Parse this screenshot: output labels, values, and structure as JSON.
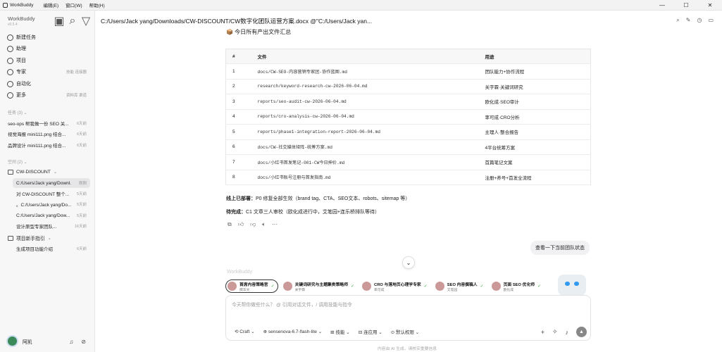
{
  "menubar": {
    "app": "WorkBuddy",
    "items": [
      "编辑(E)",
      "窗口(W)",
      "帮助(H)"
    ],
    "controls": [
      "—",
      "☐",
      "✕"
    ]
  },
  "sidebar": {
    "brand": "WorkBuddy",
    "version": "v0.5.4",
    "nav": [
      {
        "label": "新建任务",
        "hint": "",
        "icon": "edit-icon"
      },
      {
        "label": "助理",
        "hint": "",
        "icon": "assistant-icon"
      },
      {
        "label": "项目",
        "hint": "",
        "icon": "folder-icon"
      },
      {
        "label": "专家",
        "hint": "技能 连接器",
        "icon": "expert-icon"
      },
      {
        "label": "自动化",
        "hint": "",
        "icon": "clock-icon"
      },
      {
        "label": "更多",
        "hint": "资料库 渠道",
        "icon": "grid-icon"
      }
    ],
    "tasks_header": "任务 (3) ⌄",
    "tasks": [
      {
        "title": "seo-ops 帮我做一份 SEO 关...",
        "time": "6天前"
      },
      {
        "title": "视觉海报 mini111.png 结合...",
        "time": "6天前"
      },
      {
        "title": "品牌设计 mini111.png 结合...",
        "time": "6天前"
      }
    ],
    "projects_header": "空间 (2) ⌄",
    "project1": "CW-DISCOUNT",
    "project1_items": [
      {
        "title": "C:/Users/Jack yang/Downl...",
        "time": "刚刚"
      },
      {
        "title": "对 CW-DISCOUNT 整个...",
        "time": "5天前"
      },
      {
        "title": "。C:/Users/Jack yang/Do...",
        "time": "5天前"
      },
      {
        "title": "C:/Users/Jack yang/Dow...",
        "time": "5天前"
      },
      {
        "title": "设计原型专家团队...",
        "time": "16天前"
      }
    ],
    "project2": "项目新手指引",
    "project2_items": [
      {
        "title": "生成项目功能介绍",
        "time": "6天前"
      }
    ],
    "user": "阿凯"
  },
  "header": {
    "title": "C:/Users/Jack yang/Downloads/CW-DISCOUNT/CW数字化团队运营方案.docx @\"C:/Users/Jack yan..."
  },
  "content": {
    "heading": "📦 今日所有产出文件汇总",
    "table": {
      "headers": [
        "#",
        "文件",
        "用途"
      ],
      "rows": [
        [
          "1",
          "docs/CW-SEO-内容营销专家团-协作蓝图.md",
          "团队能力+协作流程"
        ],
        [
          "2",
          "research/keyword-research-cw-2026-06-04.md",
          "关宇霖·关键词研究"
        ],
        [
          "3",
          "reports/seo-audit-cw-2026-06-04.md",
          "欧化成·SEO审计"
        ],
        [
          "4",
          "reports/cro-analysis-cw-2026-06-04.md",
          "率可成·CRO分析"
        ],
        [
          "5",
          "reports/phase1-integration-report-2026-06-04.md",
          "主理人·整合报告"
        ],
        [
          "6",
          "docs/CW-社交媒体矩阵-统筹方案.md",
          "4平台统筹方案"
        ],
        [
          "7",
          "docs/小红书首发笔记-001-CW今日抻价.md",
          "首篇笔记文案"
        ],
        [
          "8",
          "docs/小红书账号注册与首发指南.md",
          "注册+养号+首发全流程"
        ]
      ]
    },
    "note1_label": "线上已部署：",
    "note1_text": "P0 修复全部生效（brand tag、CTA、SEO文本、robots、sitemap 等）",
    "note2_label": "待完成：",
    "note2_text": "C1 文章三人审校（欧化成进行中，艾笔园+连乐桥排队等待）",
    "user_message": "查看一下当前团队状态",
    "watermark": "WorkBuddy"
  },
  "agents": [
    {
      "name": "首席内容策略官",
      "role": "撰华文",
      "active": true
    },
    {
      "name": "关键词研究与主题聚类策略师",
      "role": "关宇霖",
      "active": false
    },
    {
      "name": "CRO 与落地页心理学专家",
      "role": "率可成",
      "active": false
    },
    {
      "name": "SEO 内容撰稿人",
      "role": "艾笔园",
      "active": false
    },
    {
      "name": "页面 SEO 优化师",
      "role": "欧化成",
      "active": false
    }
  ],
  "composer": {
    "placeholder": "今天帮你做些什么？ @ 引用对话文件，/ 调用技能与指令",
    "mode": "Craft",
    "model": "sensenova-6.7-flash-lite",
    "skill": "技能",
    "connector": "连应用",
    "permission": "默认权限"
  },
  "disclaimer": "内容由 AI 生成，请核实重要信息"
}
